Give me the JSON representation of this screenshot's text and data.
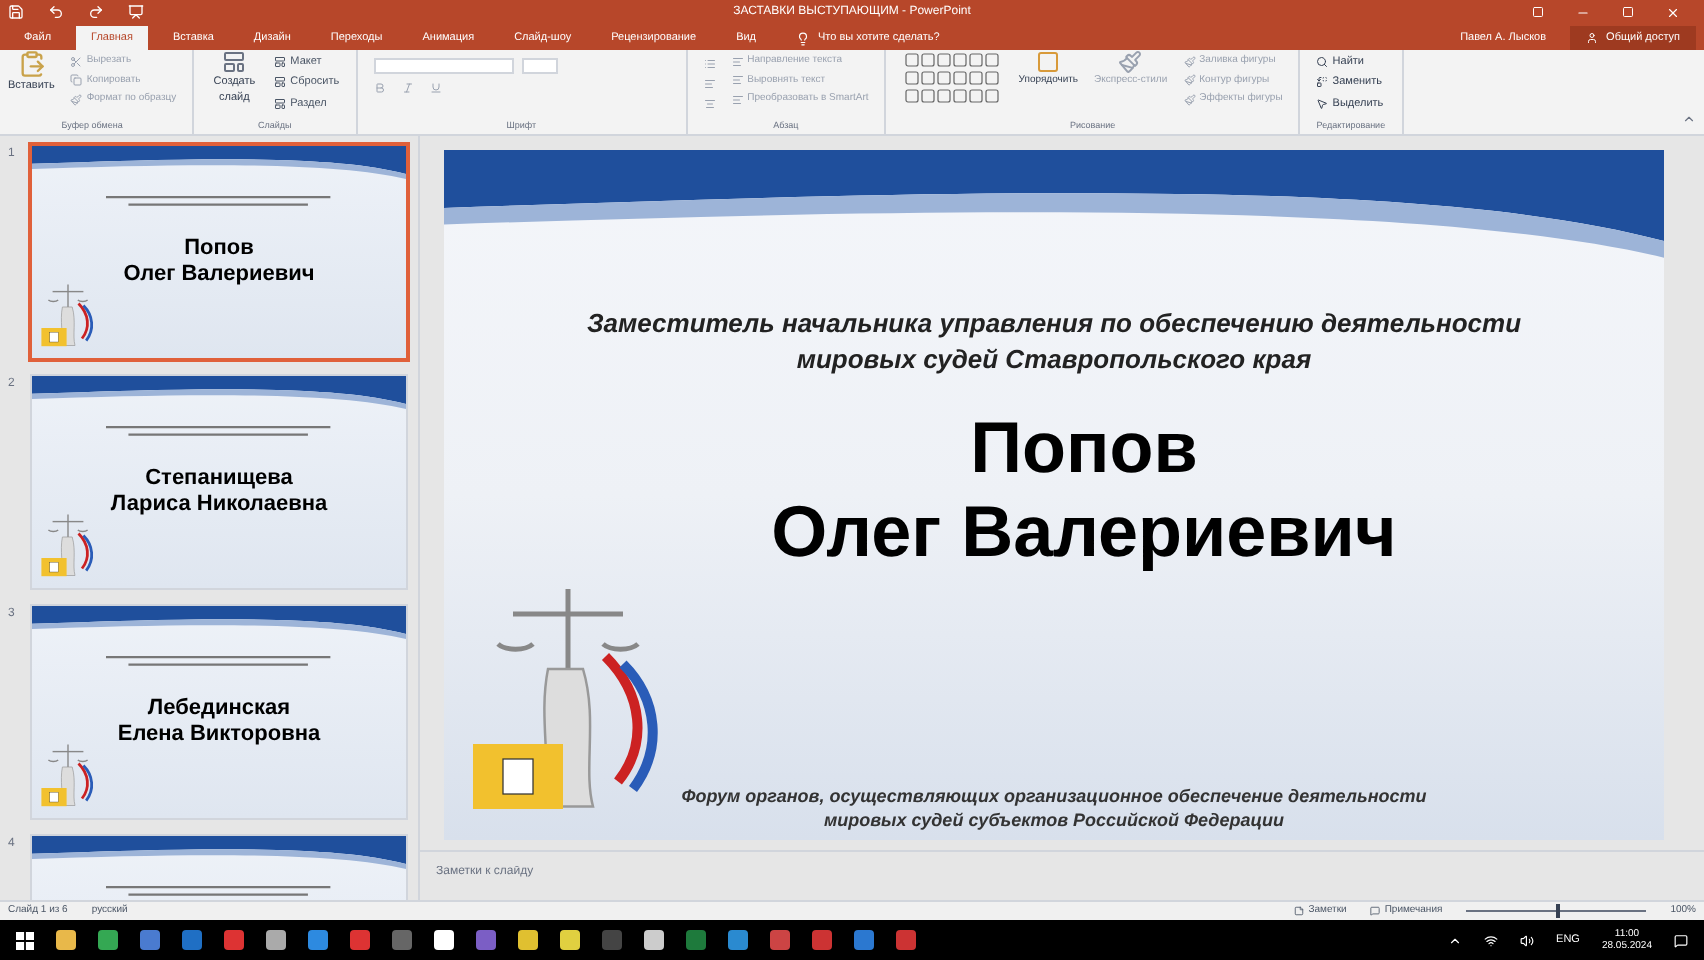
{
  "window": {
    "title": "ЗАСТАВКИ ВЫСТУПАЮЩИМ - PowerPoint",
    "user": "Павел А. Лысков",
    "share": "Общий доступ"
  },
  "tabs": [
    {
      "label": "Файл",
      "selected": false
    },
    {
      "label": "Главная",
      "selected": true
    },
    {
      "label": "Вставка",
      "selected": false
    },
    {
      "label": "Дизайн",
      "selected": false
    },
    {
      "label": "Переходы",
      "selected": false
    },
    {
      "label": "Анимация",
      "selected": false
    },
    {
      "label": "Слайд-шоу",
      "selected": false
    },
    {
      "label": "Рецензирование",
      "selected": false
    },
    {
      "label": "Вид",
      "selected": false
    }
  ],
  "tell_me": {
    "placeholder": "Что вы хотите сделать?"
  },
  "ribbon": {
    "clipboard": {
      "paste": "Вставить",
      "items": [
        "Вырезать",
        "Копировать",
        "Формат по образцу"
      ],
      "label": "Буфер обмена"
    },
    "slides": {
      "new_slide": "Создать слайд",
      "items": [
        "Макет",
        "Сбросить",
        "Раздел"
      ],
      "label": "Слайды"
    },
    "font": {
      "label": "Шрифт"
    },
    "paragraph": {
      "items": [
        "Направление текста",
        "Выровнять текст",
        "Преобразовать в SmartArt"
      ],
      "label": "Абзац"
    },
    "drawing": {
      "arrange": "Упорядочить",
      "styles": "Экспресс-стили",
      "items": [
        "Заливка фигуры",
        "Контур фигуры",
        "Эффекты фигуры"
      ],
      "label": "Рисование"
    },
    "editing": {
      "items": [
        "Найти",
        "Заменить",
        "Выделить"
      ],
      "label": "Редактирование"
    }
  },
  "thumbnails": [
    {
      "number": "1",
      "selected": true,
      "name": [
        "Попов",
        "Олег Валериевич"
      ]
    },
    {
      "number": "2",
      "selected": false,
      "name": [
        "Степанищева",
        "Лариса Николаевна"
      ]
    },
    {
      "number": "3",
      "selected": false,
      "name": [
        "Лебединская",
        "Елена Викторовна"
      ]
    },
    {
      "number": "4",
      "selected": false
    }
  ],
  "slide": {
    "subtitle": [
      "Заместитель начальника управления  по обеспечению деятельности",
      "мировых судей Ставропольского края"
    ],
    "name": [
      "Попов",
      "Олег Валериевич"
    ],
    "footer": [
      "Форум органов, осуществляющих организационное обеспечение деятельности",
      "мировых судей субъектов Российской Федерации"
    ]
  },
  "notes": {
    "placeholder": "Заметки к слайду"
  },
  "status_bar": {
    "slide": "Слайд 1 из 6",
    "language": "русский",
    "notes": "Заметки",
    "comments": "Примечания",
    "zoom": "100%",
    "zoom_level": {
      "level": 0.5
    }
  },
  "taskbar": {
    "language": "ENG",
    "time": "11:00",
    "date": "28.05.2024"
  }
}
